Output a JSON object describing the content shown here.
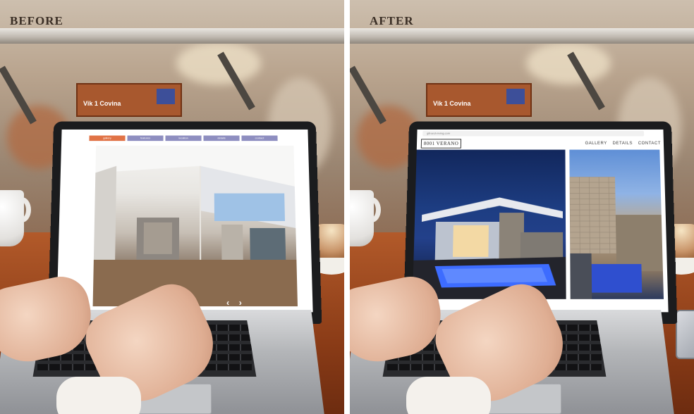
{
  "labels": {
    "before": "BEFORE",
    "after": "AFTER"
  },
  "scene": {
    "card_text": "Vik 1 Covina"
  },
  "before_site": {
    "nav": [
      "gallery",
      "features",
      "location",
      "details",
      "contact"
    ],
    "active_index": 0,
    "carousel_prev": "‹",
    "carousel_next": "›"
  },
  "after_site": {
    "url": "gill-arch-irving.com",
    "logo": "8001 VERANO",
    "nav": [
      "GALLERY",
      "DETAILS",
      "CONTACT"
    ]
  },
  "colors": {
    "old_nav": "#8e8ec0",
    "old_nav_active": "#e17346",
    "night_sky": "#1d3d82",
    "pool_glow": "#3d6cff"
  }
}
